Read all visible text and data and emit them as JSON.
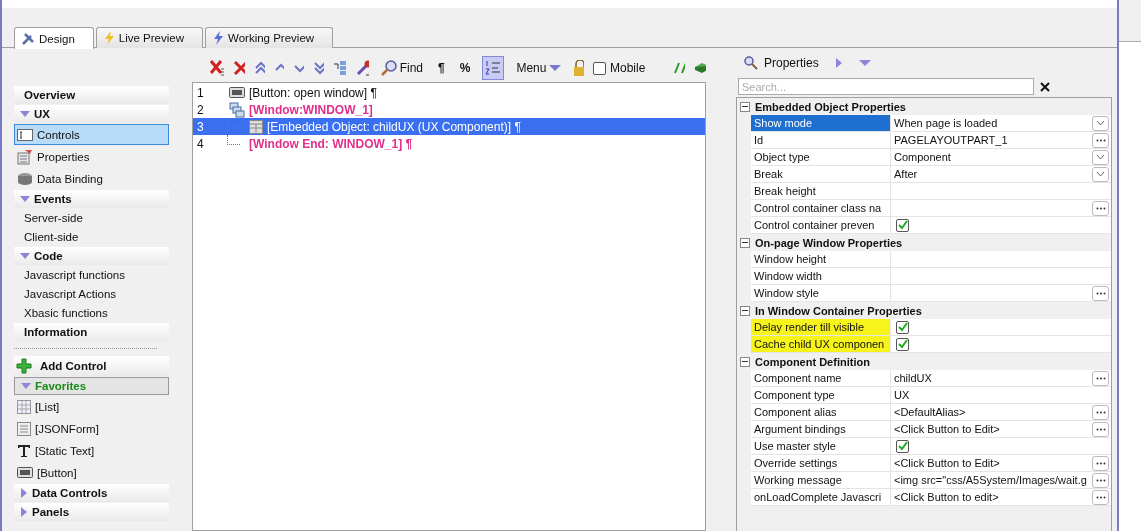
{
  "tabs": [
    {
      "label": "Design",
      "selected": true
    },
    {
      "label": "Live Preview",
      "selected": false
    },
    {
      "label": "Working Preview",
      "selected": false
    }
  ],
  "toolbar": {
    "find_label": "Find",
    "pilcrow": "¶",
    "percent": "%",
    "line_numbers": {
      "selected": true
    },
    "menu_label": "Menu",
    "mobile": {
      "label": "Mobile",
      "checked": false
    }
  },
  "sidebar": {
    "items": [
      {
        "kind": "heading",
        "label": "Overview"
      },
      {
        "kind": "group",
        "label": "UX",
        "expanded": true,
        "highlighted": false
      },
      {
        "kind": "tool",
        "label": "Controls",
        "selected": true
      },
      {
        "kind": "tool",
        "label": "Properties",
        "selected": false
      },
      {
        "kind": "tool",
        "label": "Data Binding",
        "selected": false
      },
      {
        "kind": "group",
        "label": "Events",
        "expanded": true,
        "highlighted": false
      },
      {
        "kind": "link",
        "label": "Server-side",
        "selected": false
      },
      {
        "kind": "link",
        "label": "Client-side",
        "selected": false
      },
      {
        "kind": "group",
        "label": "Code",
        "expanded": true,
        "highlighted": false
      },
      {
        "kind": "link",
        "label": "Javascript functions",
        "selected": false
      },
      {
        "kind": "link",
        "label": "Javascript Actions",
        "selected": false
      },
      {
        "kind": "link",
        "label": "Xbasic functions",
        "selected": false
      },
      {
        "kind": "heading",
        "label": "Information"
      },
      {
        "kind": "separator"
      },
      {
        "kind": "action",
        "label": "Add Control"
      },
      {
        "kind": "group",
        "label": "Favorites",
        "expanded": true,
        "highlighted": true
      },
      {
        "kind": "tool",
        "label": "[List]",
        "selected": false
      },
      {
        "kind": "tool",
        "label": "[JSONForm]",
        "selected": false
      },
      {
        "kind": "tool",
        "label": "[Static Text]",
        "selected": false
      },
      {
        "kind": "tool",
        "label": "[Button]",
        "selected": false
      },
      {
        "kind": "group",
        "label": "Data Controls",
        "expanded": false,
        "highlighted": false
      },
      {
        "kind": "group",
        "label": "Panels",
        "expanded": false,
        "highlighted": false
      }
    ]
  },
  "editor": {
    "lines": [
      {
        "number": "1",
        "kind": "button",
        "text": "[Button: open window] ¶",
        "selected": false
      },
      {
        "number": "2",
        "kind": "window",
        "text": "[Window:WINDOW_1]",
        "selected": false,
        "children": [
          {
            "number": "3",
            "kind": "embedded",
            "text": "[Embedded Object: childUX (UX Component)] ¶",
            "selected": true
          },
          {
            "number": "4",
            "kind": "window-end",
            "text": "[Window End: WINDOW_1] ¶",
            "selected": false
          }
        ]
      }
    ]
  },
  "properties": {
    "title": "Properties",
    "search": {
      "placeholder": "Search..."
    },
    "sections": [
      {
        "title": "Embedded Object Properties",
        "expanded": true,
        "rows": [
          {
            "label": "Show mode",
            "value": "When page is loaded",
            "kind": "dropdown",
            "selected": true,
            "highlighted": false
          },
          {
            "label": "Id",
            "value": "PAGELAYOUTPART_1",
            "kind": "ellipsis",
            "selected": false,
            "highlighted": false
          },
          {
            "label": "Object type",
            "value": "Component",
            "kind": "dropdown",
            "selected": false,
            "highlighted": false
          },
          {
            "label": "Break",
            "value": "After",
            "kind": "dropdown",
            "selected": false,
            "highlighted": false
          },
          {
            "label": "Break height",
            "kind": "text",
            "selected": false,
            "highlighted": false
          },
          {
            "label": "Control container class na",
            "kind": "ellipsis",
            "selected": false,
            "highlighted": false
          },
          {
            "label": "Control container preven",
            "kind": "checkbox",
            "checked": true,
            "selected": false,
            "highlighted": false
          }
        ]
      },
      {
        "title": "On-page Window Properties",
        "expanded": true,
        "rows": [
          {
            "label": "Window height",
            "kind": "text",
            "selected": false,
            "highlighted": false
          },
          {
            "label": "Window width",
            "kind": "text",
            "selected": false,
            "highlighted": false
          },
          {
            "label": "Window style",
            "kind": "ellipsis",
            "selected": false,
            "highlighted": false
          }
        ]
      },
      {
        "title": "In Window Container Properties",
        "expanded": true,
        "rows": [
          {
            "label": "Delay render till visible",
            "kind": "checkbox",
            "checked": true,
            "selected": false,
            "highlighted": true
          },
          {
            "label": "Cache child UX componen",
            "kind": "checkbox",
            "checked": true,
            "selected": false,
            "highlighted": true
          }
        ]
      },
      {
        "title": "Component Definition",
        "expanded": true,
        "rows": [
          {
            "label": "Component name",
            "value": "childUX",
            "kind": "ellipsis",
            "selected": false,
            "highlighted": false
          },
          {
            "label": "Component type",
            "value": "UX",
            "kind": "text",
            "selected": false,
            "highlighted": false
          },
          {
            "label": "Component alias",
            "value": "<DefaultAlias>",
            "kind": "ellipsis",
            "selected": false,
            "highlighted": false
          },
          {
            "label": "Argument bindings",
            "value": "<Click Button to Edit>",
            "kind": "ellipsis",
            "selected": false,
            "highlighted": false
          },
          {
            "label": "Use master style",
            "kind": "checkbox",
            "checked": true,
            "selected": false,
            "highlighted": false
          },
          {
            "label": "Override settings",
            "value": "<Click Button to Edit>",
            "kind": "ellipsis",
            "selected": false,
            "highlighted": false
          },
          {
            "label": "Working message",
            "value": "<img src=\"css/A5System/Images/wait.g",
            "kind": "ellipsis",
            "selected": false,
            "highlighted": false
          },
          {
            "label": "onLoadComplete Javascri",
            "value": "<Click Button to edit>",
            "kind": "ellipsis",
            "selected": false,
            "highlighted": false
          }
        ]
      }
    ]
  }
}
